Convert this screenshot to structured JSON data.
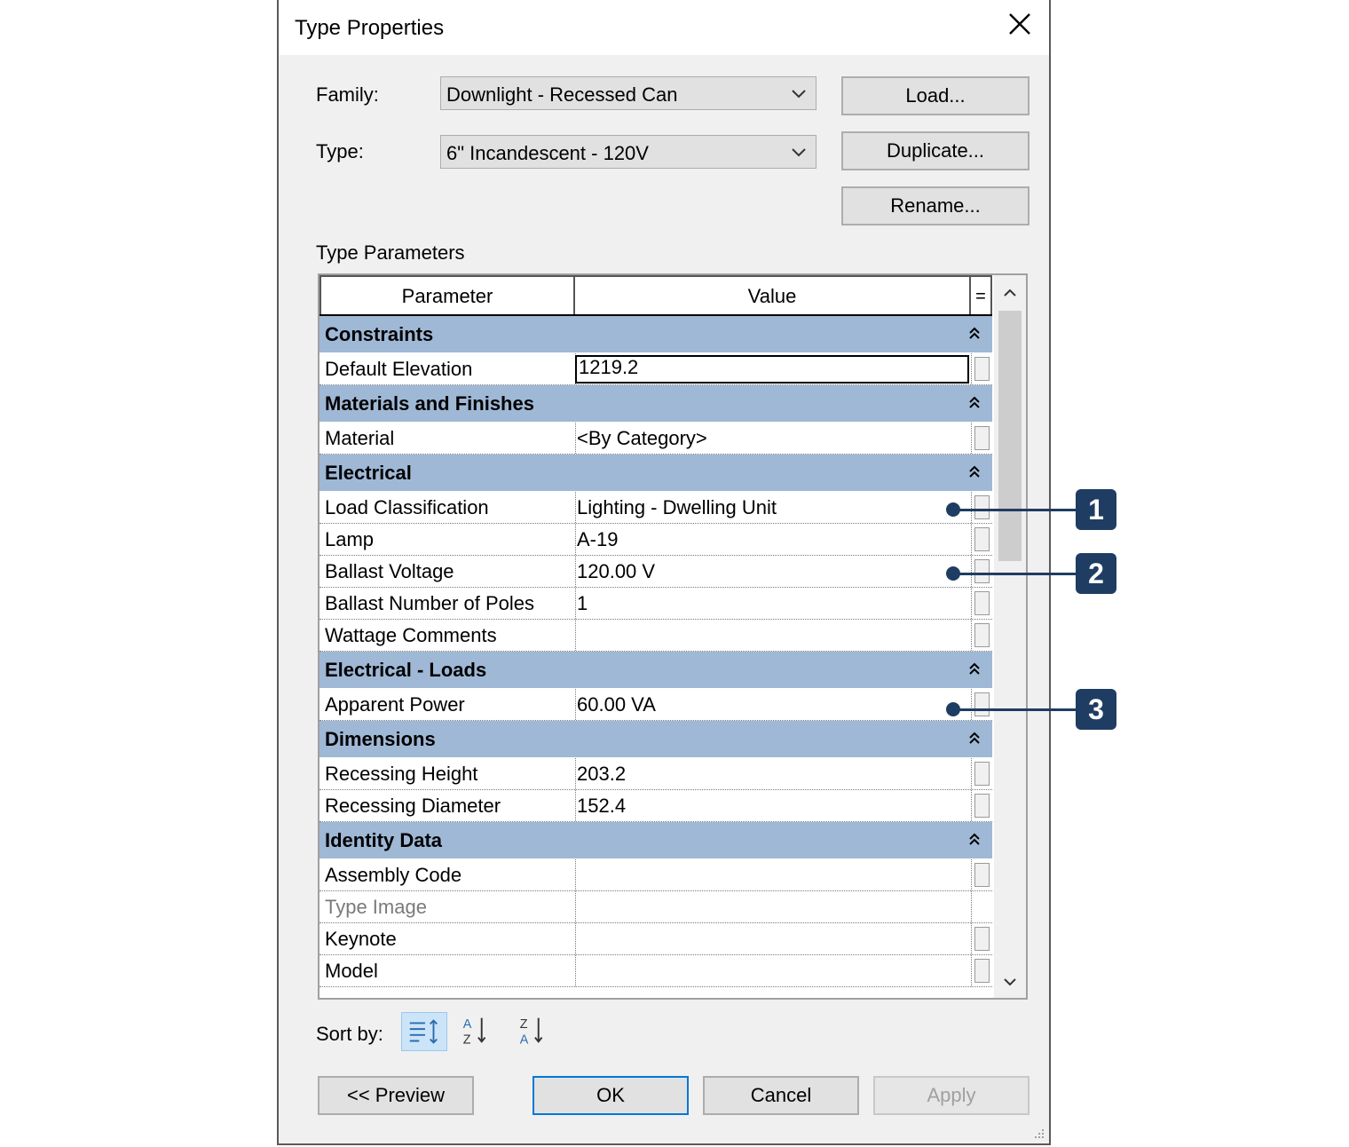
{
  "dialog": {
    "title": "Type Properties",
    "family_label": "Family:",
    "family_value": "Downlight - Recessed Can",
    "type_label": "Type:",
    "type_value": "6\" Incandescent - 120V",
    "load_button": "Load...",
    "duplicate_button": "Duplicate...",
    "rename_button": "Rename...",
    "type_parameters_label": "Type Parameters"
  },
  "grid": {
    "header_parameter": "Parameter",
    "header_value": "Value",
    "header_equals": "=",
    "groups": [
      {
        "name": "Constraints",
        "rows": [
          {
            "param": "Default Elevation",
            "value": "1219.2"
          }
        ]
      },
      {
        "name": "Materials and Finishes",
        "rows": [
          {
            "param": "Material",
            "value": "<By Category>"
          }
        ]
      },
      {
        "name": "Electrical",
        "rows": [
          {
            "param": "Load Classification",
            "value": "Lighting - Dwelling Unit"
          },
          {
            "param": "Lamp",
            "value": "A-19"
          },
          {
            "param": "Ballast Voltage",
            "value": "120.00 V"
          },
          {
            "param": "Ballast Number of Poles",
            "value": "1"
          },
          {
            "param": "Wattage Comments",
            "value": ""
          }
        ]
      },
      {
        "name": "Electrical - Loads",
        "rows": [
          {
            "param": "Apparent Power",
            "value": "60.00 VA"
          }
        ]
      },
      {
        "name": "Dimensions",
        "rows": [
          {
            "param": "Recessing Height",
            "value": "203.2"
          },
          {
            "param": "Recessing Diameter",
            "value": "152.4"
          }
        ]
      },
      {
        "name": "Identity Data",
        "rows": [
          {
            "param": "Assembly Code",
            "value": ""
          },
          {
            "param": "Type Image",
            "value": ""
          },
          {
            "param": "Keynote",
            "value": ""
          },
          {
            "param": "Model",
            "value": ""
          }
        ]
      }
    ]
  },
  "sort": {
    "label": "Sort by:"
  },
  "footer": {
    "preview_button": "<< Preview",
    "ok_button": "OK",
    "cancel_button": "Cancel",
    "apply_button": "Apply"
  },
  "callouts": [
    "1",
    "2",
    "3"
  ],
  "colors": {
    "group_header": "#9fb8d6",
    "callout": "#1f3d63",
    "ok_border": "#0078d7"
  }
}
